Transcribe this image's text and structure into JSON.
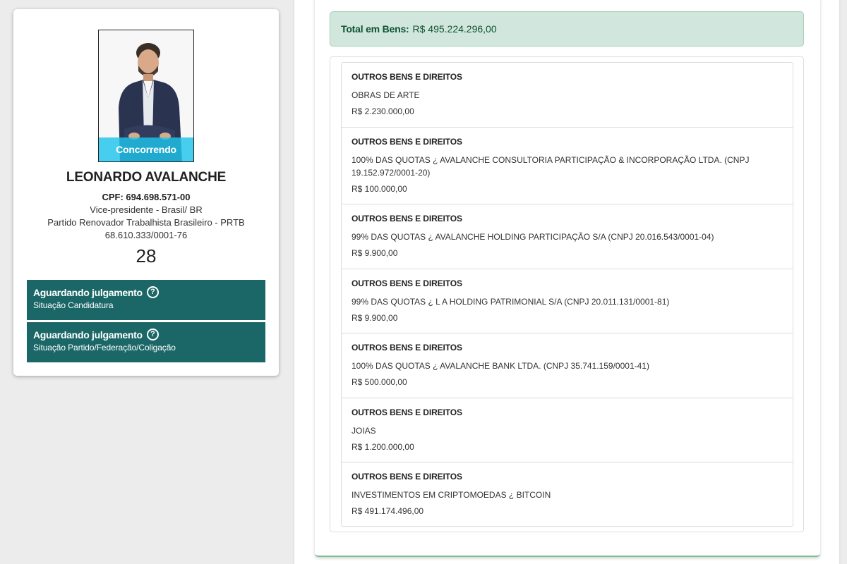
{
  "candidate": {
    "photo_badge": "Concorrendo",
    "name": "LEONARDO AVALANCHE",
    "cpf": "CPF: 694.698.571-00",
    "role": "Vice-presidente - Brasil/ BR",
    "party": "Partido Renovador Trabalhista Brasileiro - PRTB",
    "party_cnpj": "68.610.333/0001-76",
    "number": "28",
    "statuses": [
      {
        "title": "Aguardando julgamento",
        "subtitle": "Situação Candidatura",
        "icon": "help-circle-icon"
      },
      {
        "title": "Aguardando julgamento",
        "subtitle": "Situação Partido/Federação/Coligação",
        "icon": "help-circle-icon"
      }
    ]
  },
  "assets": {
    "total_label": "Total em Bens:",
    "total_value": "R$ 495.224.296,00",
    "items": [
      {
        "type": "OUTROS BENS E DIREITOS",
        "description": "OBRAS DE ARTE",
        "value": "R$ 2.230.000,00"
      },
      {
        "type": "OUTROS BENS E DIREITOS",
        "description": "100% DAS QUOTAS ¿ AVALANCHE CONSULTORIA PARTICIPAÇÃO & INCORPORAÇÃO LTDA. (CNPJ 19.152.972/0001-20)",
        "value": "R$ 100.000,00"
      },
      {
        "type": "OUTROS BENS E DIREITOS",
        "description": "99% DAS QUOTAS ¿ AVALANCHE HOLDING PARTICIPAÇÃO S/A (CNPJ 20.016.543/0001-04)",
        "value": "R$ 9.900,00"
      },
      {
        "type": "OUTROS BENS E DIREITOS",
        "description": "99% DAS QUOTAS ¿ L A HOLDING PATRIMONIAL S/A (CNPJ 20.011.131/0001-81)",
        "value": "R$ 9.900,00"
      },
      {
        "type": "OUTROS BENS E DIREITOS",
        "description": "100% DAS QUOTAS ¿ AVALANCHE BANK LTDA. (CNPJ 35.741.159/0001-41)",
        "value": "R$ 500.000,00"
      },
      {
        "type": "OUTROS BENS E DIREITOS",
        "description": "JOIAS",
        "value": "R$ 1.200.000,00"
      },
      {
        "type": "OUTROS BENS E DIREITOS",
        "description": "INVESTIMENTOS EM CRIPTOMOEDAS ¿ BITCOIN",
        "value": "R$ 491.174.496,00"
      }
    ]
  },
  "colors": {
    "status_bg": "#1b6767",
    "badge_bg": "#20c4ec",
    "total_bg": "#d1e7dd",
    "total_text": "#0f5132"
  }
}
